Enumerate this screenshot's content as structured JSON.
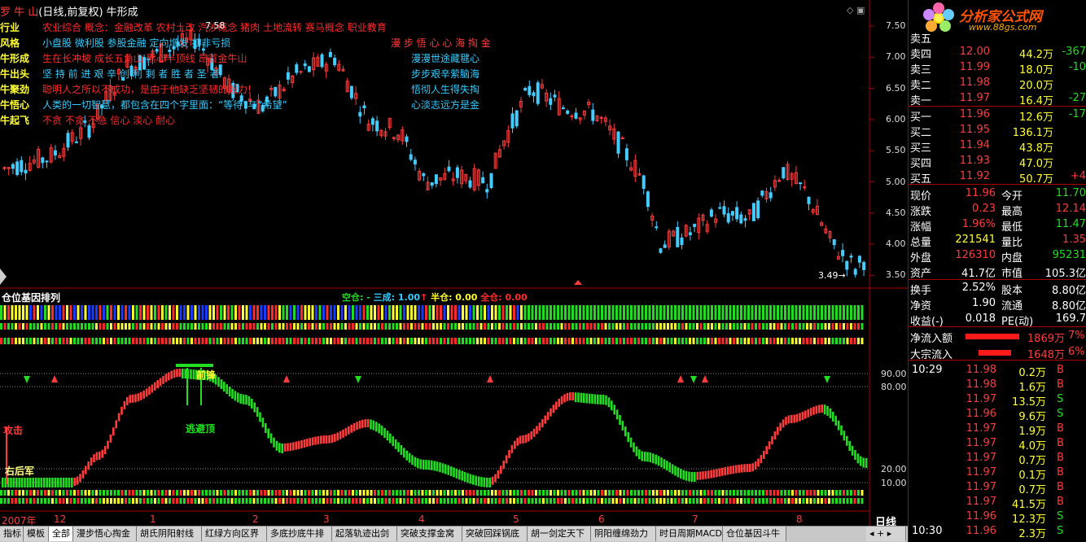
{
  "header": {
    "logo_text": "罗 牛 山",
    "title_rest": "(日线,前复权) 牛形成"
  },
  "info": [
    {
      "key": "行业",
      "value": "农业综合   概念：金融改革 农村土改 汽沙概念 猪肉 土地流转 赛马概念 职业教育",
      "extra": ""
    },
    {
      "key": "风格",
      "value": "小盘股 微利股 参股金融 定向增发 扣非亏损",
      "extra": "漫 步 悟 心 心 海 掏 金"
    },
    {
      "key": "牛形成",
      "value": "生在长冲坡 成长五角山 熊心半顶线 昂首金牛山",
      "extra": "漫漫世途藏毽心"
    },
    {
      "key": "牛出头",
      "value": "坚 持 前 进  艰 辛 创 利  剩 者  胜 者  圣 者",
      "extra": "步步艰辛萦脑海"
    },
    {
      "key": "牛聚劲",
      "value": "聪明人之所以不成功，是由于他缺乏坚韧的毅力!",
      "extra": "悟彻人生得失掏"
    },
    {
      "key": "牛悟心",
      "value": "人类的一切智慧，都包含在四个字里面：“等待”与“希望”",
      "extra": "心淡志远方是金"
    },
    {
      "key": "牛起飞",
      "value": "不贪 不贪 不急 信心 淡心 耐心",
      "extra": ""
    }
  ],
  "price_axis": [
    "7.50",
    "7.00",
    "6.50",
    "6.00",
    "5.50",
    "5.00",
    "4.50",
    "4.00",
    "3.50"
  ],
  "high_marker": "7.58",
  "low_marker": "3.49",
  "indicator": {
    "name": "仓位基因排列",
    "legend_empty": "空仓: -",
    "legend_three": "三成: 1.00",
    "legend_half": "半仓: 0.00",
    "legend_full": "全仓: 0.00",
    "axis": [
      "90.00",
      "80.00",
      "20.00",
      "10.00"
    ],
    "label_attack": "攻击",
    "label_rear": "右后军",
    "label_front": "前锋",
    "label_escape": "逃避顶"
  },
  "time_axis": [
    "2007年",
    "12",
    "1",
    "2",
    "3",
    "4",
    "5",
    "6",
    "7",
    "8"
  ],
  "period_label": "日线",
  "watermark": {
    "text": "分析家公式网",
    "url": "www.88gs.com"
  },
  "order_book": {
    "sell": [
      {
        "label": "卖五",
        "price": "",
        "vol": "",
        "chg": ""
      },
      {
        "label": "卖四",
        "price": "12.00",
        "vol": "44.2万",
        "chg": "-367"
      },
      {
        "label": "卖三",
        "price": "11.99",
        "vol": "18.0万",
        "chg": "-10"
      },
      {
        "label": "卖二",
        "price": "11.98",
        "vol": "20.0万",
        "chg": ""
      },
      {
        "label": "卖一",
        "price": "11.97",
        "vol": "16.4万",
        "chg": "-27"
      }
    ],
    "buy": [
      {
        "label": "买一",
        "price": "11.96",
        "vol": "12.6万",
        "chg": "-17"
      },
      {
        "label": "买二",
        "price": "11.95",
        "vol": "136.1万",
        "chg": ""
      },
      {
        "label": "买三",
        "price": "11.94",
        "vol": "43.8万",
        "chg": ""
      },
      {
        "label": "买四",
        "price": "11.93",
        "vol": "47.0万",
        "chg": ""
      },
      {
        "label": "买五",
        "price": "11.92",
        "vol": "50.7万",
        "chg": "+4"
      }
    ]
  },
  "stats": [
    {
      "l1": "现价",
      "v1": "11.96",
      "l2": "今开",
      "v2": "11.70",
      "c1": "red",
      "c2": "grn"
    },
    {
      "l1": "涨跌",
      "v1": "0.23",
      "l2": "最高",
      "v2": "12.14",
      "c1": "red",
      "c2": "red"
    },
    {
      "l1": "涨幅",
      "v1": "1.96%",
      "l2": "最低",
      "v2": "11.47",
      "c1": "red",
      "c2": "grn"
    },
    {
      "l1": "总量",
      "v1": "221541",
      "l2": "量比",
      "v2": "1.35",
      "c1": "yel",
      "c2": "red"
    },
    {
      "l1": "外盘",
      "v1": "126310",
      "l2": "内盘",
      "v2": "95231",
      "c1": "red",
      "c2": "grn"
    },
    {
      "l1": "资产",
      "v1": "41.7亿",
      "l2": "市值",
      "v2": "105.3亿",
      "c1": "wht",
      "c2": "wht"
    },
    {
      "l1": "换手",
      "v1": "2.52%",
      "l2": "股本",
      "v2": "8.80亿",
      "c1": "wht",
      "c2": "wht"
    },
    {
      "l1": "净资",
      "v1": "1.90",
      "l2": "流通",
      "v2": "8.80亿",
      "c1": "wht",
      "c2": "wht"
    },
    {
      "l1": "收益(-)",
      "v1": "0.018",
      "l2": "PE(动)",
      "v2": "169.7",
      "c1": "wht",
      "c2": "wht"
    }
  ],
  "flows": [
    {
      "label": "净流入额",
      "value": "1869万",
      "pct": "7%"
    },
    {
      "label": "大宗流入",
      "value": "1648万",
      "pct": "6%"
    }
  ],
  "ticks": [
    {
      "time": "10:29",
      "price": "11.98",
      "vol": "0.2万",
      "side": "B"
    },
    {
      "time": "",
      "price": "11.98",
      "vol": "1.6万",
      "side": "B"
    },
    {
      "time": "",
      "price": "11.97",
      "vol": "13.5万",
      "side": "S"
    },
    {
      "time": "",
      "price": "11.96",
      "vol": "9.6万",
      "side": "S"
    },
    {
      "time": "",
      "price": "11.97",
      "vol": "1.9万",
      "side": "B"
    },
    {
      "time": "",
      "price": "11.97",
      "vol": "4.0万",
      "side": "B"
    },
    {
      "time": "",
      "price": "11.97",
      "vol": "0.7万",
      "side": "B"
    },
    {
      "time": "",
      "price": "11.97",
      "vol": "0.1万",
      "side": "B"
    },
    {
      "time": "",
      "price": "11.97",
      "vol": "0.7万",
      "side": "B"
    },
    {
      "time": "",
      "price": "11.97",
      "vol": "41.5万",
      "side": "B"
    },
    {
      "time": "",
      "price": "11.96",
      "vol": "12.3万",
      "side": "S"
    },
    {
      "time": "10:30",
      "price": "11.96",
      "vol": "2.3万",
      "side": "S"
    }
  ],
  "tabs": [
    "指标",
    "模板",
    "全部",
    "漫步悟心掏金",
    "胡氏阴阳射线",
    "红绿方向区界",
    "多底抄底牛排",
    "起落轨迹出剑",
    "突破支撑金窝",
    "突破回踩锅底",
    "胡一剑定天下",
    "阴阳缠绵劲力",
    "时日周期MACD",
    "仓位基因斗牛"
  ],
  "active_tab": 2,
  "colors": {
    "up": "#ff3b3b",
    "down": "#44ccff",
    "grid": "#aa0000",
    "green": "#22dd22"
  }
}
